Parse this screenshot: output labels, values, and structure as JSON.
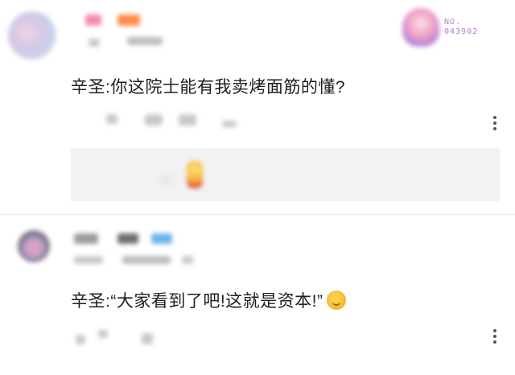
{
  "badge": {
    "no_label": "NO.",
    "number": "043902",
    "color": "#b37fd6"
  },
  "comments": [
    {
      "text": "辛圣:你这院士能有我卖烤面筋的懂?",
      "emoji": ""
    },
    {
      "text": "辛圣:“大家看到了吧!这就是资本!”",
      "emoji": "grimacing-face-icon"
    }
  ],
  "colors": {
    "text": "#1e1e1e",
    "reply_box_bg": "#f2f2f2",
    "divider": "#ececec",
    "kebab": "#555555"
  }
}
